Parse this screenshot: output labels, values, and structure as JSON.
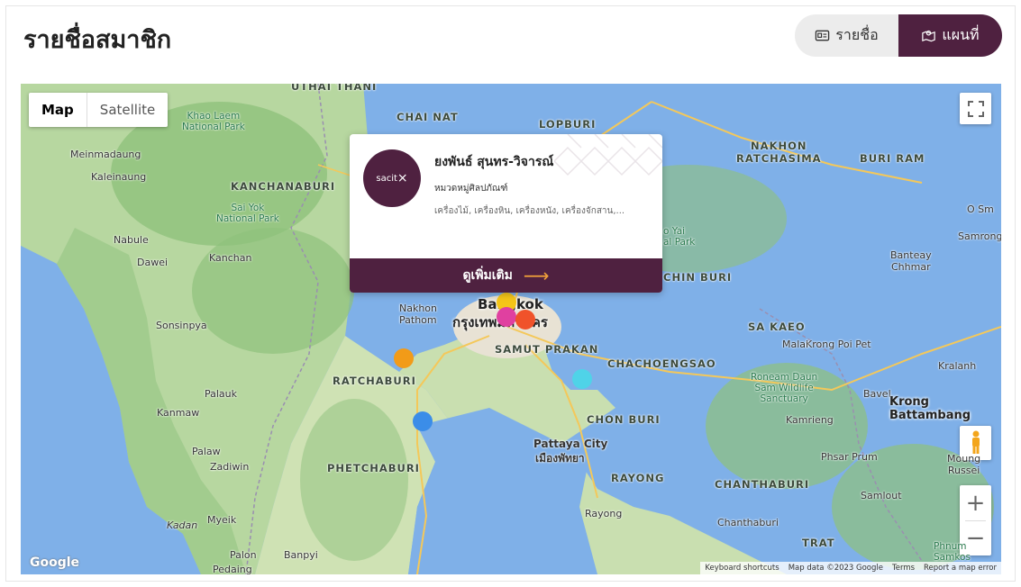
{
  "page": {
    "title": "รายชื่อสมาชิก"
  },
  "view_toggle": {
    "list_label": "รายชื่อ",
    "map_label": "แผนที่",
    "active": "map"
  },
  "map": {
    "type_controls": {
      "map": "Map",
      "satellite": "Satellite"
    },
    "google_logo": "Google",
    "attribution": [
      "Keyboard shortcuts",
      "Map data ©2023 Google",
      "Terms",
      "Report a map error"
    ],
    "zoom_in": "+",
    "zoom_out": "−",
    "labels": {
      "uthai_thani": "UTHAI THANI",
      "chai_nat": "CHAI NAT",
      "lopburi": "LOPBURI",
      "nakhon_ratchasima": "NAKHON\nRATCHASIMA",
      "buri_ram": "BURI RAM",
      "kanchanaburi": "KANCHANABURI",
      "chachoengsao": "CHACHOENGSAO",
      "samut_prakan": "SAMUT PRAKAN",
      "ratchaburi": "RATCHABURI",
      "chon_buri": "CHON BURI",
      "sa_kaeo": "SA KAEO",
      "phetchaburi": "PHETCHABURI",
      "rayong": "RAYONG",
      "chanthaburi": "CHANTHABURI",
      "trat": "TRAT",
      "prachin_buri": "CHIN BURI",
      "bangkok": "Bangkok",
      "bangkok_th": "กรุงเทพมหานคร",
      "pattaya": "Pattaya City",
      "pattaya_th": "เมืองพัทยา",
      "meinmadaung": "Meinmadaung",
      "kaleinaung": "Kaleinaung",
      "nabule": "Nabule",
      "dawei": "Dawei",
      "sonsinpya": "Sonsinpya",
      "palauk": "Palauk",
      "kanmaw": "Kanmaw",
      "palaw": "Palaw",
      "zadiwin": "Zadiwin",
      "kadan": "Kadan",
      "myeik": "Myeik",
      "palon": "Palon",
      "banpyi": "Banpyi",
      "pedaing": "Pedaing",
      "khao_laem": "Khao Laem\nNational Park",
      "sai_yok": "Sai Yok\nNational Park",
      "nakhon_pathom": "Nakhon\nPathom",
      "krong_poi_pet": "Krong Poi Pet",
      "malai": "Malai",
      "kralanh": "Kralanh",
      "banteay_chhmar": "Banteay\nChhmar",
      "bavel": "Bavel",
      "krong_battambang": "Krong\nBattambang",
      "kamrieng": "Kamrieng",
      "phsar_prum": "Phsar Prum",
      "moung_russei": "Moung\nRussei",
      "samlout": "Samlout",
      "roneam_daun_sam": "Roneam Daun\nSam Wildlife\nSanctuary",
      "phnum_samkos": "Phnum\nSamkos",
      "rayong_town": "Rayong",
      "chanthaburi_town": "Chanthaburi",
      "o_sm": "O Sm",
      "samrong": "Samrong",
      "kanchan": "Kanchan",
      "o_yai": "o Yai\nal Park"
    }
  },
  "markers": [
    {
      "name": "marker-yellow",
      "color": "#f5c518"
    },
    {
      "name": "marker-pink",
      "color": "#e040a0"
    },
    {
      "name": "marker-red",
      "color": "#f0522a"
    },
    {
      "name": "marker-orange",
      "color": "#f29b18"
    },
    {
      "name": "marker-cyan",
      "color": "#4fd3e8"
    },
    {
      "name": "marker-blue",
      "color": "#3b8de8"
    }
  ],
  "popup": {
    "avatar_text": "sacit",
    "name": "ยงพันธ์ สุนทร-วิจารณ์",
    "category": "หมวดหมู่ศิลปภัณฑ์",
    "items": "เครื่องไม้, เครื่องหิน, เครื่องหนัง, เครื่องจักสาน,...",
    "more_label": "ดูเพิ่มเติม",
    "more_arrow": "⟶"
  },
  "colors": {
    "brand": "#4f2140",
    "water": "#7fb0e8",
    "land": "#a9cf97"
  }
}
